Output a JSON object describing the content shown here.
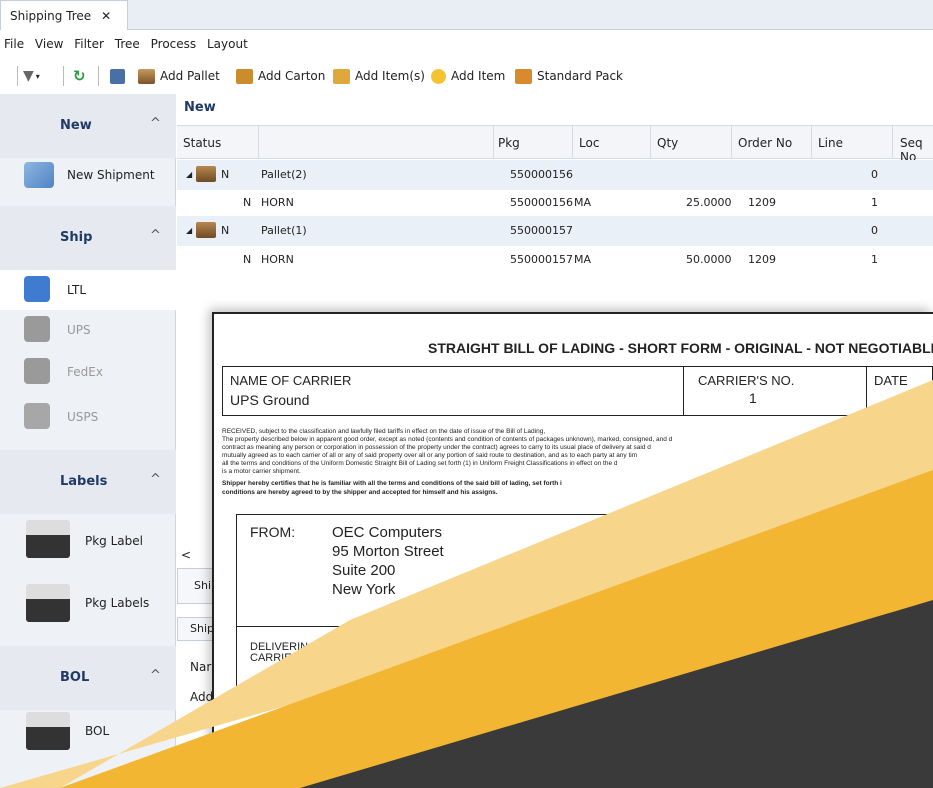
{
  "tab": {
    "title": "Shipping Tree",
    "close": "✕"
  },
  "menu": [
    "File",
    "View",
    "Filter",
    "Tree",
    "Process",
    "Layout"
  ],
  "toolbar": {
    "add_pallet": "Add Pallet",
    "add_carton": "Add Carton",
    "add_items": "Add Item(s)",
    "add_item": "Add Item",
    "standard_pack": "Standard Pack"
  },
  "sidebar": {
    "new": {
      "title": "New",
      "items": [
        "New Shipment"
      ]
    },
    "ship": {
      "title": "Ship",
      "items": [
        "LTL",
        "UPS",
        "FedEx",
        "USPS"
      ]
    },
    "labels": {
      "title": "Labels",
      "items": [
        "Pkg Label",
        "Pkg Labels"
      ]
    },
    "bol": {
      "title": "BOL",
      "items": [
        "BOL"
      ]
    },
    "chevron": "^"
  },
  "grid": {
    "title": "New",
    "columns": [
      "Status",
      "",
      "Pkg",
      "Loc",
      "Qty",
      "Order No",
      "Line",
      "Seq No"
    ],
    "rows": [
      {
        "status": "N",
        "desc": "Pallet(2)",
        "pkg": "550000156",
        "loc": "",
        "qty": "",
        "order": "",
        "seq": "0"
      },
      {
        "status": "N",
        "desc": "HORN",
        "pkg": "550000156",
        "loc": "MA",
        "qty": "25.0000",
        "order": "1209",
        "seq": "1"
      },
      {
        "status": "N",
        "desc": "Pallet(1)",
        "pkg": "550000157",
        "loc": "",
        "qty": "",
        "order": "",
        "seq": "0"
      },
      {
        "status": "N",
        "desc": "HORN",
        "pkg": "550000157",
        "loc": "MA",
        "qty": "50.0000",
        "order": "1209",
        "seq": "1"
      }
    ],
    "scroll_left": "<",
    "bottom_tab1": "Shi",
    "bottom_tab2": "Ship",
    "field1": "Nar",
    "field2": "Add"
  },
  "bol": {
    "title": "STRAIGHT BILL OF LADING - SHORT FORM - ORIGINAL - NOT NEGOTIABLE",
    "carrier_label": "NAME OF CARRIER",
    "carrier_value": "UPS Ground",
    "carrier_no_label": "CARRIER'S NO.",
    "carrier_no_value": "1",
    "date_label": "DATE",
    "fine_print": [
      "RECEIVED, subject to the classification and lawfully filed tariffs in effect on the date of issue of the Bill of Lading,",
      "The property described below in apparent good order, except as noted (contents and condition of contents of packages unknown), marked, consigned, and d",
      "contract as meaning any person or corporation in possession of the property under the contract) agrees to carry to its usual place of delivery at said d",
      "mutually agreed as to each carrier of all or any of said property over all or any portion of said route to destination, and as to each party at any tim",
      "all the terms and conditions of the Uniform Domestic Straight Bill of Lading set forth (1) in Uniform Freight Classifications in effect on the d",
      "is a motor carrier shipment.",
      "Shipper hereby certifies that he is familiar with all the terms and conditions of the said bill of lading, set forth i",
      "conditions are hereby agreed to by the shipper and accepted for himself and his assigns."
    ],
    "from_label": "FROM:",
    "from_lines": [
      "OEC Computers",
      "95 Morton Street",
      "Suite 200",
      "New York"
    ],
    "delivering_label": "DELIVERING",
    "carrier_partial": "CARRIER"
  },
  "colors": {
    "accent": "#1f3a66",
    "chevron_yellow": "#f2b632",
    "chevron_light": "#f7cc6a",
    "chevron_dark": "#3a3a3a"
  }
}
